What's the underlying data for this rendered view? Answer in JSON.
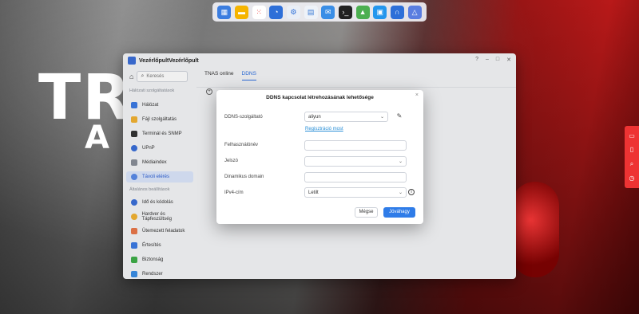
{
  "window": {
    "title": "VezérlőpultVezérlőpult"
  },
  "dock": {
    "icons": [
      "file-manager",
      "notes",
      "apps",
      "clock",
      "settings",
      "files",
      "mail",
      "terminal",
      "android",
      "docker",
      "support",
      "drive"
    ]
  },
  "sidebar": {
    "home_label": "",
    "search_placeholder": "Keresés",
    "group1": "Hálózati szolgáltatások",
    "group2": "Általános beállítások",
    "items": [
      {
        "label": "Hálózat"
      },
      {
        "label": "Fájl szolgáltatás"
      },
      {
        "label": "Terminál és SNMP"
      },
      {
        "label": "UPnP"
      },
      {
        "label": "Médiaindex"
      },
      {
        "label": "Távoli elérés"
      },
      {
        "label": "Idő és kódolás"
      },
      {
        "label": "Hardver és Tápfeszültség"
      },
      {
        "label": "Ütemezett feladatok"
      },
      {
        "label": "Értesítés"
      },
      {
        "label": "Biztonság"
      },
      {
        "label": "Rendszer"
      }
    ]
  },
  "tabs": [
    "TNAS online",
    "DDNS"
  ],
  "dialog": {
    "title": "DDNS kapcsolat létrehozásának lehetősége",
    "provider_label": "DDNS-szolgáltató",
    "provider_value": "aliyun",
    "register_link": "Regisztráció most",
    "username_label": "Felhasználónév",
    "password_label": "Jelszó",
    "domain_label": "Dinamikus domain",
    "ipv4_label": "IPv4-cím",
    "ipv4_value": "Letilt",
    "cancel": "Mégse",
    "ok": "Jóváhagy"
  },
  "wallpaper": {
    "brand_big": "TR",
    "brand_small": "A"
  }
}
